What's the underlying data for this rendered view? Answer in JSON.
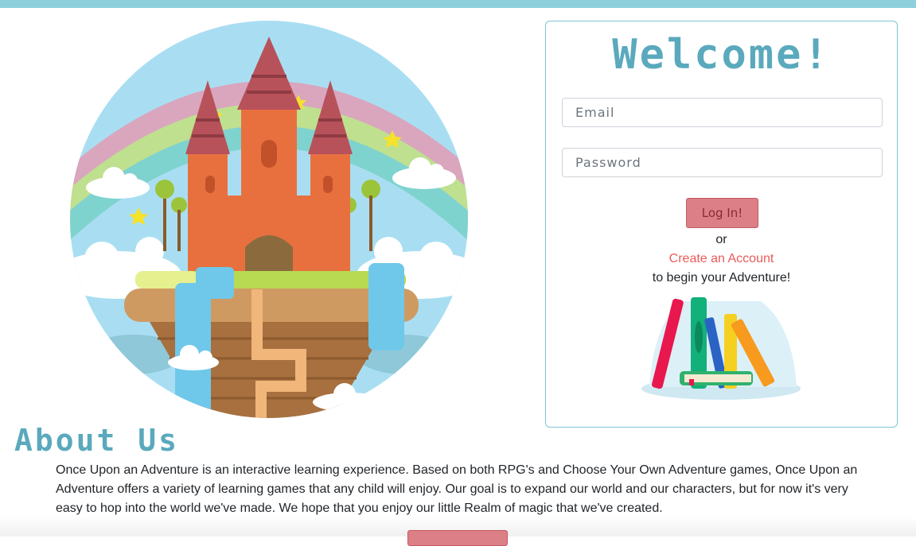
{
  "header": {
    "accent": "#8ecfdc"
  },
  "hero": {
    "image": "castle-island-illustration"
  },
  "login": {
    "title": "Welcome!",
    "email_placeholder": "Email",
    "password_placeholder": "Password",
    "login_label": "Log In!",
    "or_text": "or",
    "create_account_label": "Create an Account",
    "begin_text": "to begin your Adventure!",
    "books_image": "books-illustration"
  },
  "about": {
    "title": "About Us",
    "body": "Once Upon an Adventure is an interactive learning experience. Based on both RPG's and Choose Your Own Adventure games, Once Upon an Adventure offers a variety of learning games that any child will enjoy. Our goal is to expand our world and our characters, but for now it's very easy to hop into the world we've made. We hope that you enjoy our little Realm of magic that we've created."
  },
  "colors": {
    "title_color": "#5aa9bd",
    "button_color": "#dc7f86",
    "link_color": "#e85b5b",
    "border_color": "#7cc6d3"
  }
}
